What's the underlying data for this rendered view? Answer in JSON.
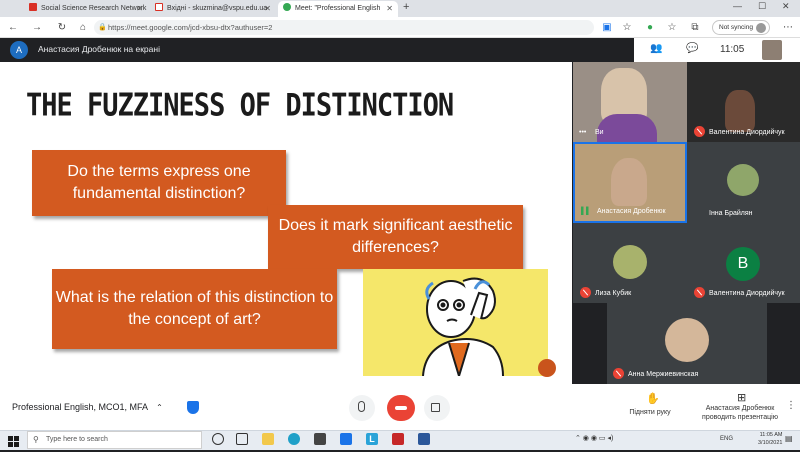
{
  "browser": {
    "tabs": [
      {
        "label": "Social Science Research Network",
        "icon_color": "#d93025"
      },
      {
        "label": "Вхідні - skuzmina@vspu.edu.ua",
        "icon_color": "#d93025"
      },
      {
        "label": "Meet: \"Professional English",
        "icon_color": "#1a73e8"
      }
    ],
    "address": "https://meet.google.com/jcd-xbsu-dtx?authuser=2",
    "sync_label": "Not syncing"
  },
  "meet": {
    "presenter_initial": "A",
    "presenter_label": "Анастасия Дробенюк на екрані",
    "clock": "11:05",
    "meeting_name": "Professional English, MCO1, MFA",
    "raise_hand_label": "Підняти руку",
    "presenting_label_line1": "Анастасия Дробенюк",
    "presenting_label_line2": "проводить презентацію"
  },
  "slide": {
    "title": "THE FUZZINESS OF DISTINCTION",
    "questions": [
      "Do the terms express one fundamental distinction?",
      "Does it mark significant aesthetic differences?",
      "What is the relation of this distinction to the concept of art?"
    ]
  },
  "participants": [
    {
      "name": "Ви"
    },
    {
      "name": "Валентина Диордийчук"
    },
    {
      "name": "Анастасия Дробенюк"
    },
    {
      "name": "Інна Брайлян"
    },
    {
      "name": "Лиза Кубик"
    },
    {
      "name": "Валентина Диордийчук",
      "initial": "B"
    },
    {
      "name": "Анна Мержиевинская"
    }
  ],
  "taskbar": {
    "search_placeholder": "Type here to search",
    "tray_lang": "ENG",
    "tray_time": "11:05 AM",
    "tray_date": "3/10/2021"
  },
  "colors": {
    "accent_orange": "#d35a20",
    "meet_dark": "#202124",
    "end_call_red": "#ea4335",
    "avatar_green": "#0b8043"
  }
}
